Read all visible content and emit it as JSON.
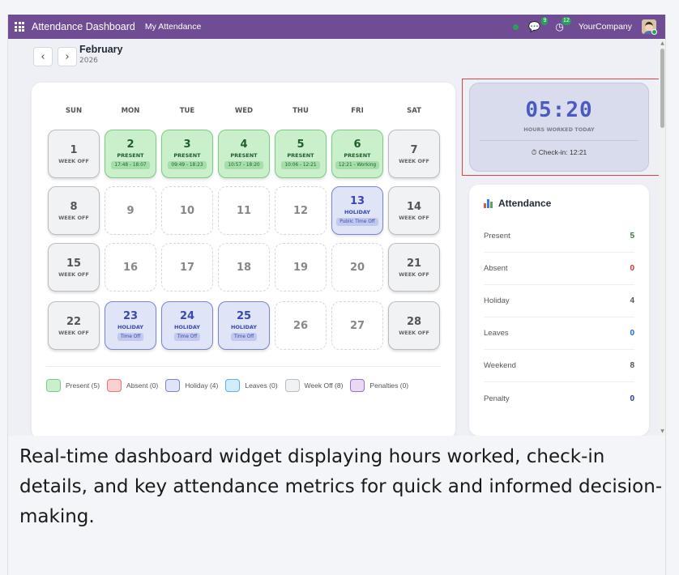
{
  "topbar": {
    "app_title": "Attendance Dashboard",
    "menu_item": "My Attendance",
    "chat_badge": "9",
    "activity_badge": "12",
    "company": "YourCompany",
    "colors": {
      "bar": "#6f4c94",
      "online": "#29a05a"
    }
  },
  "month_nav": {
    "prev_icon": "‹",
    "next_icon": "›",
    "month": "February",
    "year": "2026"
  },
  "calendar": {
    "weekdays": [
      "SUN",
      "MON",
      "TUE",
      "WED",
      "THU",
      "FRI",
      "SAT"
    ],
    "weeks": [
      [
        {
          "day": "1",
          "type": "weekoff",
          "status": "WEEK OFF",
          "note": ""
        },
        {
          "day": "2",
          "type": "present",
          "status": "PRESENT",
          "note": "17:48 - 18:07"
        },
        {
          "day": "3",
          "type": "present",
          "status": "PRESENT",
          "note": "09:49 - 18:23"
        },
        {
          "day": "4",
          "type": "present",
          "status": "PRESENT",
          "note": "10:57 - 18:20"
        },
        {
          "day": "5",
          "type": "present",
          "status": "PRESENT",
          "note": "10:06 - 12:21"
        },
        {
          "day": "6",
          "type": "present",
          "status": "PRESENT",
          "note": "12:21 - Working"
        },
        {
          "day": "7",
          "type": "weekoff",
          "status": "WEEK OFF",
          "note": ""
        }
      ],
      [
        {
          "day": "8",
          "type": "weekoff",
          "status": "WEEK OFF",
          "note": ""
        },
        {
          "day": "9",
          "type": "empty",
          "status": "",
          "note": ""
        },
        {
          "day": "10",
          "type": "empty",
          "status": "",
          "note": ""
        },
        {
          "day": "11",
          "type": "empty",
          "status": "",
          "note": ""
        },
        {
          "day": "12",
          "type": "empty",
          "status": "",
          "note": ""
        },
        {
          "day": "13",
          "type": "holiday",
          "status": "HOLIDAY",
          "note": "Public Time Off"
        },
        {
          "day": "14",
          "type": "weekoff",
          "status": "WEEK OFF",
          "note": ""
        }
      ],
      [
        {
          "day": "15",
          "type": "weekoff",
          "status": "WEEK OFF",
          "note": ""
        },
        {
          "day": "16",
          "type": "empty",
          "status": "",
          "note": ""
        },
        {
          "day": "17",
          "type": "empty",
          "status": "",
          "note": ""
        },
        {
          "day": "18",
          "type": "empty",
          "status": "",
          "note": ""
        },
        {
          "day": "19",
          "type": "empty",
          "status": "",
          "note": ""
        },
        {
          "day": "20",
          "type": "empty",
          "status": "",
          "note": ""
        },
        {
          "day": "21",
          "type": "weekoff",
          "status": "WEEK OFF",
          "note": ""
        }
      ],
      [
        {
          "day": "22",
          "type": "weekoff",
          "status": "WEEK OFF",
          "note": ""
        },
        {
          "day": "23",
          "type": "holiday",
          "status": "HOLIDAY",
          "note": "Time Off"
        },
        {
          "day": "24",
          "type": "holiday",
          "status": "HOLIDAY",
          "note": "Time Off"
        },
        {
          "day": "25",
          "type": "holiday",
          "status": "HOLIDAY",
          "note": "Time Off"
        },
        {
          "day": "26",
          "type": "empty",
          "status": "",
          "note": ""
        },
        {
          "day": "27",
          "type": "empty",
          "status": "",
          "note": ""
        },
        {
          "day": "28",
          "type": "weekoff",
          "status": "WEEK OFF",
          "note": ""
        }
      ]
    ]
  },
  "legend": [
    {
      "label": "Present (5)",
      "fill": "#c9f0cb",
      "border": "#7ccb83"
    },
    {
      "label": "Absent (0)",
      "fill": "#fbd0d0",
      "border": "#e57373"
    },
    {
      "label": "Holiday (4)",
      "fill": "#dfe4f7",
      "border": "#7886cf"
    },
    {
      "label": "Leaves (0)",
      "fill": "#d3ecfa",
      "border": "#5fb0e0"
    },
    {
      "label": "Week Off (8)",
      "fill": "#f1f2f4",
      "border": "#b9bcc2"
    },
    {
      "label": "Penalties (0)",
      "fill": "#ead9f3",
      "border": "#a070c0"
    }
  ],
  "hours_widget": {
    "time": "05:20",
    "label": "HOURS WORKED TODAY",
    "checkin": "Check-in: 12:21"
  },
  "attendance": {
    "title": "Attendance",
    "rows": [
      {
        "label": "Present",
        "value": "5",
        "color": "#2e7d32"
      },
      {
        "label": "Absent",
        "value": "0",
        "color": "#d32f2f"
      },
      {
        "label": "Holiday",
        "value": "4",
        "color": "#555555"
      },
      {
        "label": "Leaves",
        "value": "0",
        "color": "#1565c0"
      },
      {
        "label": "Weekend",
        "value": "8",
        "color": "#555555"
      },
      {
        "label": "Penalty",
        "value": "0",
        "color": "#283593"
      }
    ]
  },
  "caption": "Real-time dashboard widget displaying hours worked, check-in details, and key attendance metrics for quick and informed decision-making."
}
